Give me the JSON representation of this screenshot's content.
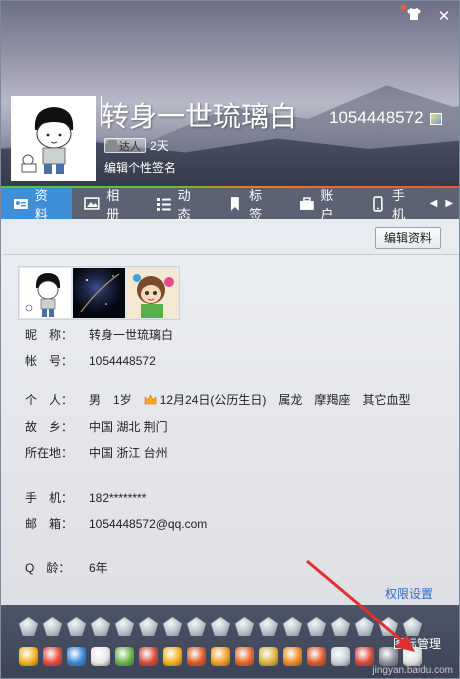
{
  "header": {
    "nickname": "转身一世琉璃白",
    "qq_number": "1054448572",
    "level_badge": "达人",
    "level_days": "2天",
    "signature_placeholder": "编辑个性签名"
  },
  "tabs": [
    {
      "label": "资料",
      "icon": "profile-card-icon",
      "active": true
    },
    {
      "label": "相册",
      "icon": "album-icon",
      "active": false
    },
    {
      "label": "动态",
      "icon": "feed-list-icon",
      "active": false
    },
    {
      "label": "标签",
      "icon": "bookmark-icon",
      "active": false
    },
    {
      "label": "账户",
      "icon": "briefcase-icon",
      "active": false
    },
    {
      "label": "手机",
      "icon": "phone-icon",
      "active": false
    }
  ],
  "edit_button": "编辑资料",
  "profile": {
    "nickname_label": "昵　称：",
    "nickname_value": "转身一世琉璃白",
    "account_label": "帐　号：",
    "account_value": "1054448572",
    "personal_label": "个　人：",
    "gender": "男",
    "age": "1岁",
    "birthday": "12月24日(公历生日)",
    "zodiac": "属龙",
    "constellation": "摩羯座",
    "blood": "其它血型",
    "hometown_label": "故　乡：",
    "hometown_value": "中国 湖北 荆门",
    "location_label": "所在地：",
    "location_value": "中国 浙江 台州",
    "phone_label": "手　机：",
    "phone_value": "182********",
    "email_label": "邮　箱：",
    "email_value": "1054448572@qq.com",
    "qage_label": "Q　龄：",
    "qage_value": "6年"
  },
  "permission_link": "权限设置",
  "badge_manage": "图标管理",
  "watermark": "jingyan.baidu.com",
  "colors": {
    "tab_active": "#3e8fd8",
    "tab_bar": "#5d6273",
    "link": "#2d6ec5",
    "arrow": "#e0302e"
  }
}
